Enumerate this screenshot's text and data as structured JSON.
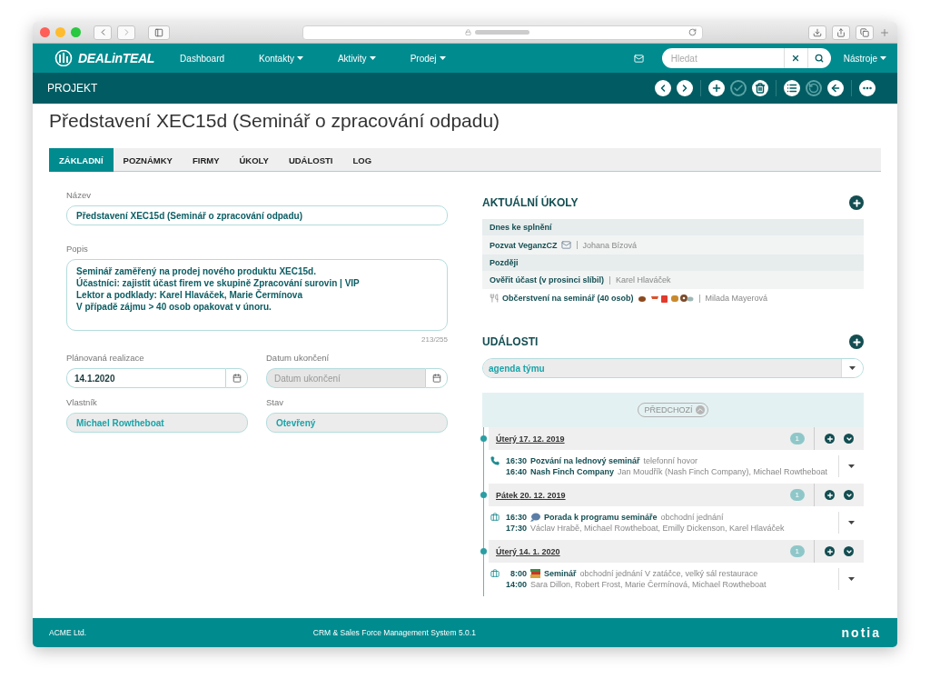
{
  "app": {
    "logo": "DEALinTEAL",
    "nav": [
      {
        "label": "Dashboard",
        "dropdown": false
      },
      {
        "label": "Kontakty",
        "dropdown": true
      },
      {
        "label": "Aktivity",
        "dropdown": true
      },
      {
        "label": "Prodej",
        "dropdown": true
      }
    ],
    "search": {
      "placeholder": "Hledat"
    },
    "tools": "Nástroje"
  },
  "section": {
    "title": "PROJEKT",
    "toolbar": [
      {
        "buttons": [
          {
            "kind": "prev",
            "disabled": false
          },
          {
            "kind": "next",
            "disabled": false
          }
        ]
      },
      {
        "buttons": [
          {
            "kind": "add",
            "disabled": false
          },
          {
            "kind": "check",
            "disabled": true
          },
          {
            "kind": "trash",
            "disabled": false
          }
        ]
      },
      {
        "buttons": [
          {
            "kind": "list",
            "disabled": false
          },
          {
            "kind": "undo",
            "disabled": true
          },
          {
            "kind": "back",
            "disabled": false
          }
        ]
      },
      {
        "buttons": [
          {
            "kind": "more",
            "disabled": false
          }
        ]
      }
    ]
  },
  "title": "Představení XEC15d (Seminář o zpracování odpadu)",
  "tabs": [
    {
      "label": "ZÁKLADNÍ",
      "selected": true
    },
    {
      "label": "POZNÁMKY",
      "selected": false
    },
    {
      "label": "FIRMY",
      "selected": false
    },
    {
      "label": "ÚKOLY",
      "selected": false
    },
    {
      "label": "UDÁLOSTI",
      "selected": false
    },
    {
      "label": "LOG",
      "selected": false
    }
  ],
  "form": {
    "name": {
      "label": "Název",
      "value": "Představení XEC15d (Seminář o zpracování odpadu)"
    },
    "description": {
      "label": "Popis",
      "lines": [
        "Seminář zaměřený na prodej nového produktu XEC15d.",
        "Účastníci: zajistit účast firem ve skupině Zpracování surovin | VIP",
        "Lektor a podklady: Karel Hlaváček, Marie Čermínova",
        "V případě zájmu > 40 osob opakovat v únoru."
      ],
      "counter": "213/255"
    },
    "dates": [
      {
        "label": "Plánovaná realizace",
        "value": "14.1.2020",
        "disabled": false
      },
      {
        "label": "Datum ukončení",
        "placeholder": "Datum ukončení",
        "disabled": true
      }
    ],
    "selects": [
      {
        "label": "Vlastník",
        "value": "Michael Rowtheboat"
      },
      {
        "label": "Stav",
        "value": "Otevřený"
      }
    ]
  },
  "tasks": {
    "title": "AKTUÁLNÍ ÚKOLY",
    "groups": [
      {
        "label": "Dnes ke splnění",
        "items": [
          {
            "kind": "invite",
            "title": "Pozvat VeganzCZ",
            "person": "Johana Bízová",
            "highlighted": true
          }
        ]
      },
      {
        "label": "Později",
        "items": [
          {
            "kind": "plain",
            "title": "Ověřit účast (v prosinci slíbil)",
            "person": "Karel Hlaváček",
            "highlighted": true
          },
          {
            "kind": "catering",
            "title": "Občerstvení na seminář (40 osob)",
            "person": "Milada Mayerová",
            "highlighted": false
          }
        ]
      }
    ]
  },
  "events": {
    "title": "UDÁLOSTI",
    "filter": "agenda týmu",
    "previous": "PŘEDCHOZÍ",
    "days": [
      {
        "weekday": "Úterý",
        "date": "17. 12. 2019",
        "count": "1",
        "events": [
          {
            "kind": "call",
            "start": "16:30",
            "title": "Pozvání na lednový seminář",
            "detail": "telefonní hovor",
            "end": "16:40",
            "company": "Nash Finch Company",
            "people": "Jan Moudřík (Nash Finch Company), Michael Rowtheboat"
          }
        ]
      },
      {
        "weekday": "Pátek",
        "date": "20. 12. 2019",
        "count": "1",
        "events": [
          {
            "kind": "consultation",
            "start": "16:30",
            "title": "Porada k programu semináře",
            "detail": "obchodní jednání",
            "end": "17:30",
            "people": "Václav Hrabě, Michael Rowtheboat, Emilly Dickenson, Karel Hlaváček"
          }
        ]
      },
      {
        "weekday": "Úterý",
        "date": "14. 1. 2020",
        "count": "1",
        "events": [
          {
            "kind": "seminar",
            "start": "8:00",
            "title": "Seminář",
            "detail": "obchodní jednání V zatáčce, velký sál restaurace",
            "end": "14:00",
            "people": "Sara Dillon, Robert Frost, Marie Čermínová, Michael Rowtheboat"
          }
        ]
      }
    ]
  },
  "footer": {
    "left": "ACME Ltd.",
    "center": "CRM & Sales Force Management System 5.0.1",
    "brand": "notia"
  }
}
